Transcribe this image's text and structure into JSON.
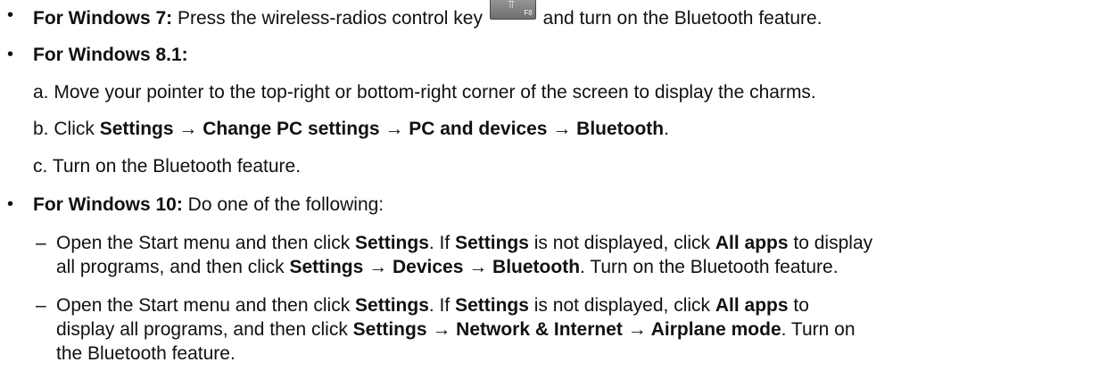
{
  "bullets": {
    "glyph": "•",
    "dash": "–"
  },
  "win7": {
    "label": "For Windows 7:",
    "text_before_key": "Press the wireless-radios control key",
    "key_icon": "wireless-antenna-icon",
    "key_label": "F8",
    "text_after_key": "and turn on the Bluetooth feature."
  },
  "win81": {
    "label": "For Windows 8.1:",
    "step_a": {
      "marker": "a.",
      "text": "Move your pointer to the top-right or bottom-right corner of the screen to display the charms."
    },
    "step_b": {
      "marker": "b.",
      "prefix": "Click",
      "path": "Settings → Change PC settings → PC and devices → Bluetooth",
      "suffix": "."
    },
    "step_c": {
      "marker": "c.",
      "text": "Turn on the Bluetooth feature."
    }
  },
  "win10": {
    "label": "For Windows 10:",
    "text": "Do one of the following:",
    "option1": {
      "l1_a": "Open the Start menu and then click",
      "l1_b": "Settings",
      "l1_c": ". If",
      "l1_d": "Settings",
      "l1_e": "is not displayed, click",
      "l1_f": "All apps",
      "l1_g": "to display",
      "l2_a": "all programs, and then click",
      "l2_b": "Settings → Devices → Bluetooth",
      "l2_c": ". Turn on the Bluetooth feature."
    },
    "option2": {
      "l1_a": "Open the Start menu and then click",
      "l1_b": "Settings",
      "l1_c": ". If",
      "l1_d": "Settings",
      "l1_e": "is not displayed, click",
      "l1_f": "All apps",
      "l1_g": "to",
      "l2_a": "display all programs, and then click",
      "l2_b": "Settings → Network & Internet → Airplane mode",
      "l2_c": ". Turn on",
      "l3": "the Bluetooth feature."
    }
  }
}
